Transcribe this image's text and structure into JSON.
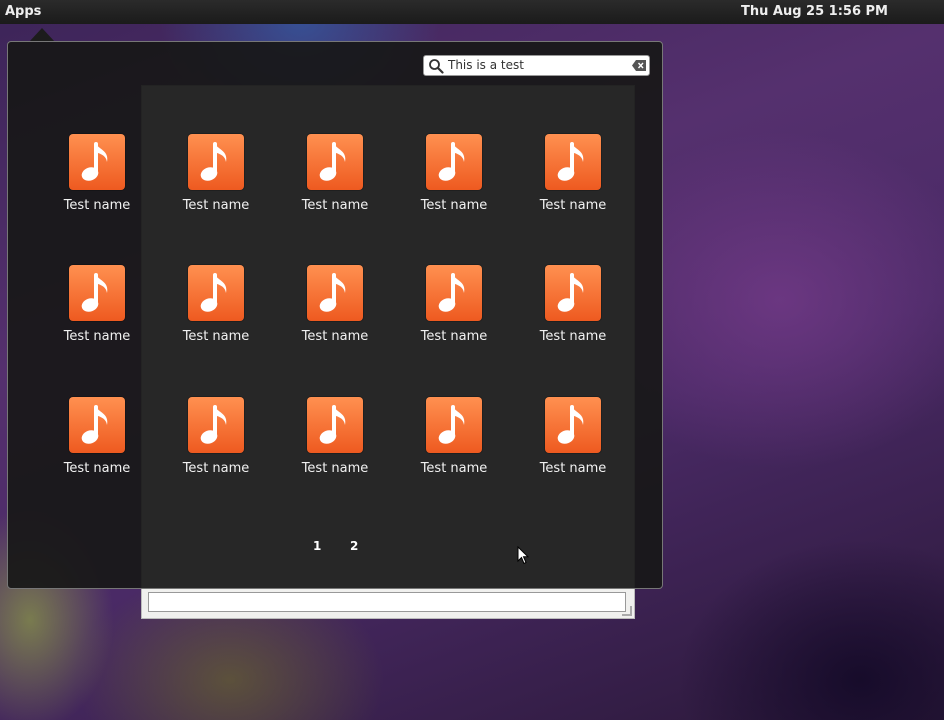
{
  "top_panel": {
    "apps_label": "Apps",
    "datetime": "Thu Aug 25  1:56 PM"
  },
  "launcher": {
    "search": {
      "value": "This is a test",
      "icon": "search-icon",
      "clear_icon": "clear-text-icon"
    },
    "apps": [
      {
        "label": "Test name",
        "icon": "music-note-icon"
      },
      {
        "label": "Test name",
        "icon": "music-note-icon"
      },
      {
        "label": "Test name",
        "icon": "music-note-icon"
      },
      {
        "label": "Test name",
        "icon": "music-note-icon"
      },
      {
        "label": "Test name",
        "icon": "music-note-icon"
      },
      {
        "label": "Test name",
        "icon": "music-note-icon"
      },
      {
        "label": "Test name",
        "icon": "music-note-icon"
      },
      {
        "label": "Test name",
        "icon": "music-note-icon"
      },
      {
        "label": "Test name",
        "icon": "music-note-icon"
      },
      {
        "label": "Test name",
        "icon": "music-note-icon"
      },
      {
        "label": "Test name",
        "icon": "music-note-icon"
      },
      {
        "label": "Test name",
        "icon": "music-note-icon"
      },
      {
        "label": "Test name",
        "icon": "music-note-icon"
      },
      {
        "label": "Test name",
        "icon": "music-note-icon"
      },
      {
        "label": "Test name",
        "icon": "music-note-icon"
      }
    ],
    "pages": [
      "1",
      "2"
    ]
  },
  "colors": {
    "app_icon_top": "#ff9050",
    "app_icon_bottom": "#ee5a20",
    "launcher_bg": "#181818"
  }
}
